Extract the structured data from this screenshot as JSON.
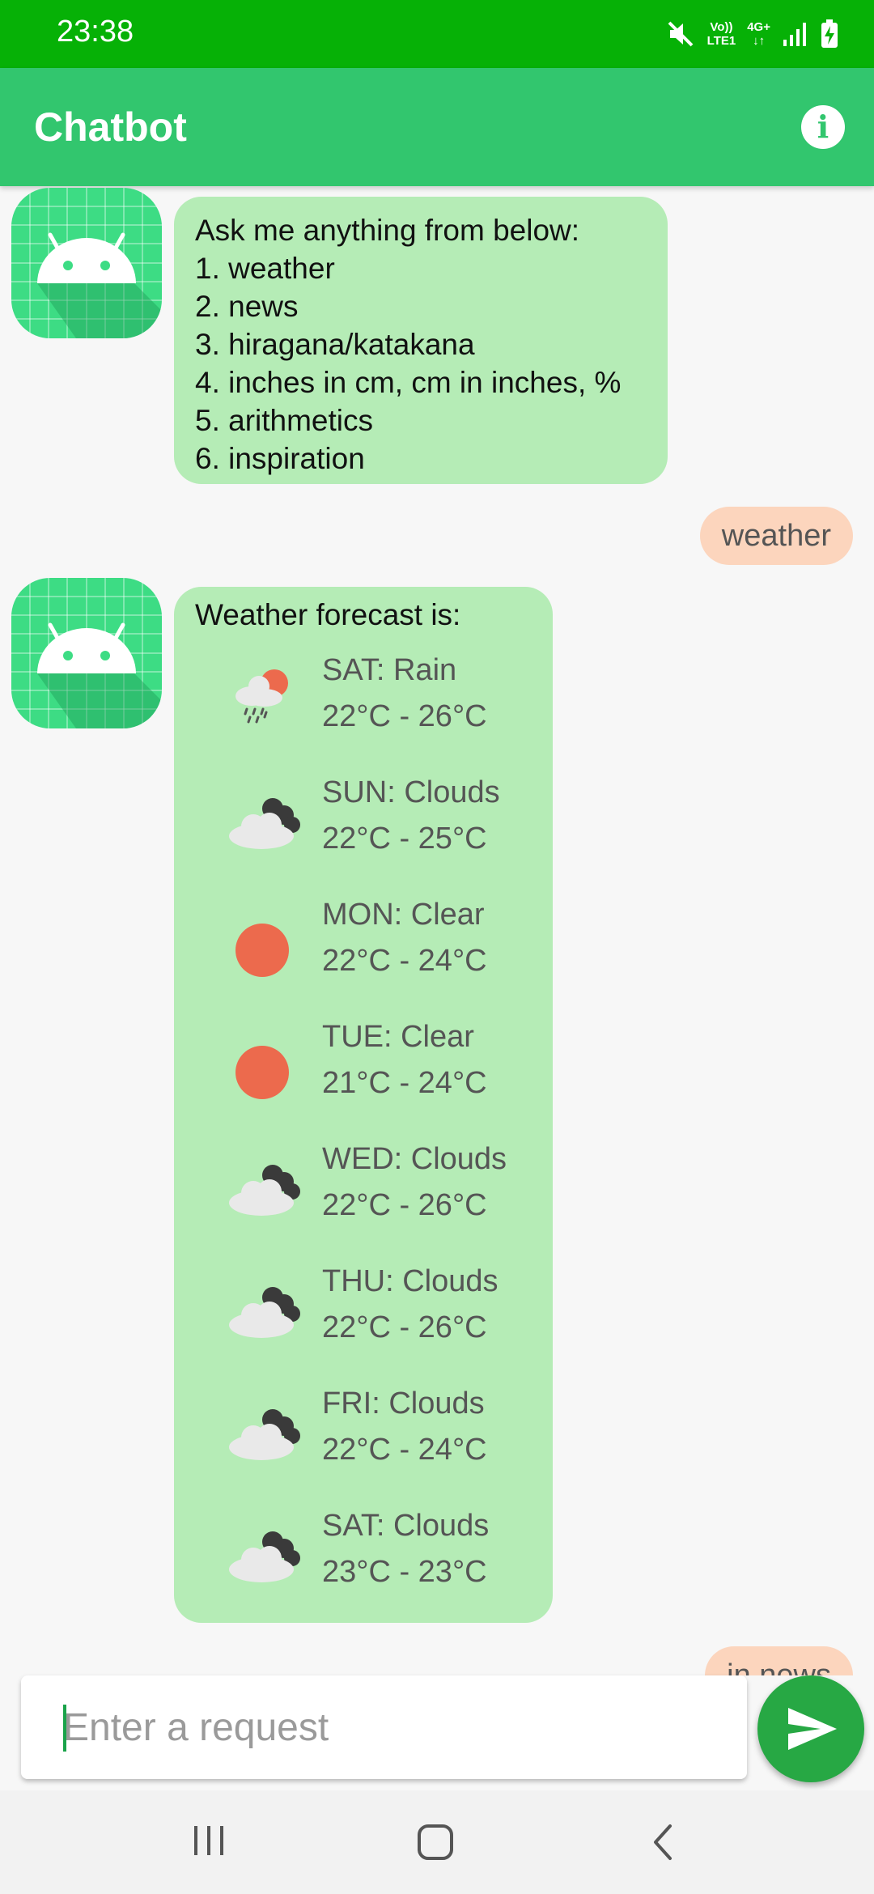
{
  "status_bar": {
    "time": "23:38",
    "network_top": "Vo))",
    "network_bottom": "LTE1",
    "data_type": "4G+"
  },
  "app_bar": {
    "title": "Chatbot",
    "info_icon": "info-icon"
  },
  "messages": {
    "menu": {
      "lines": [
        "Ask me anything from below:",
        "1. weather",
        "2. news",
        "3. hiragana/katakana",
        "4. inches in cm, cm in inches, %",
        "5. arithmetics",
        "6. inspiration"
      ]
    },
    "user_weather": "weather",
    "forecast": {
      "heading": "Weather forecast is:",
      "days": [
        {
          "day": "SAT: Rain",
          "range": "22°C - 26°C",
          "icon": "rain-icon"
        },
        {
          "day": "SUN: Clouds",
          "range": "22°C - 25°C",
          "icon": "clouds-icon"
        },
        {
          "day": "MON: Clear",
          "range": "22°C - 24°C",
          "icon": "clear-icon"
        },
        {
          "day": "TUE: Clear",
          "range": "21°C - 24°C",
          "icon": "clear-icon"
        },
        {
          "day": "WED: Clouds",
          "range": "22°C - 26°C",
          "icon": "clouds-icon"
        },
        {
          "day": "THU: Clouds",
          "range": "22°C - 26°C",
          "icon": "clouds-icon"
        },
        {
          "day": "FRI: Clouds",
          "range": "22°C - 24°C",
          "icon": "clouds-icon"
        },
        {
          "day": "SAT: Clouds",
          "range": "23°C - 23°C",
          "icon": "clouds-icon"
        }
      ]
    },
    "user_news_partial": "in news"
  },
  "input": {
    "placeholder": "Enter a request",
    "value": ""
  },
  "colors": {
    "status_bar": "#06b106",
    "app_bar": "#32c66e",
    "bot_bubble": "#b5ecb6",
    "user_bubble": "#fcd5bd",
    "send_button": "#27a844",
    "sun": "#ec6a4d"
  }
}
